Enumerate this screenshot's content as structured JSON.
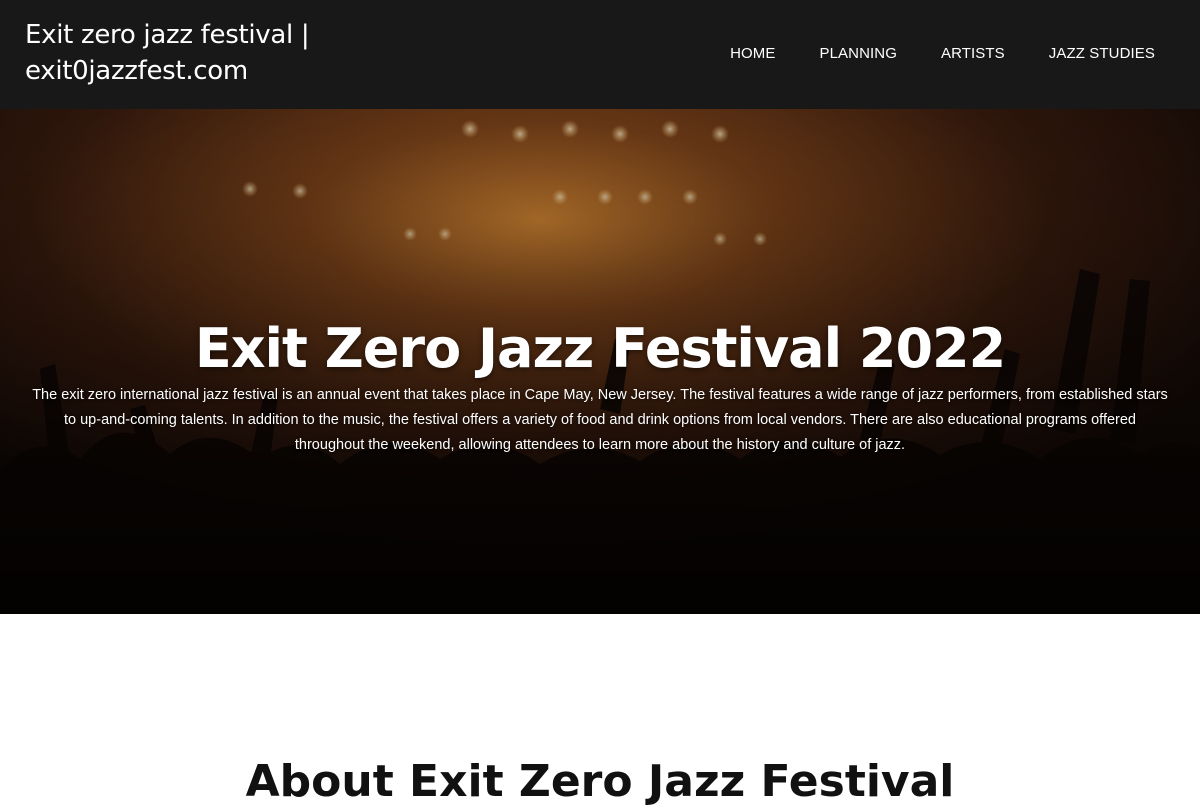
{
  "header": {
    "site_title": "Exit zero jazz festival | exit0jazzfest.com",
    "nav": [
      {
        "label": "HOME"
      },
      {
        "label": "PLANNING"
      },
      {
        "label": "ARTISTS"
      },
      {
        "label": "JAZZ STUDIES"
      }
    ]
  },
  "hero": {
    "title": "Exit Zero Jazz Festival 2022",
    "description": "The exit zero international jazz festival is an annual event that takes place in Cape May, New Jersey. The festival features a wide range of jazz performers, from established stars to up-and-coming talents. In addition to the music, the festival offers a variety of food and drink options from local vendors. There are also educational programs offered throughout the weekend, allowing attendees to learn more about the history and culture of jazz."
  },
  "about": {
    "title": "About Exit Zero Jazz Festival"
  },
  "colors": {
    "header_bg": "#181818",
    "hero_glow": "#c87a28",
    "text": "#ffffff"
  }
}
